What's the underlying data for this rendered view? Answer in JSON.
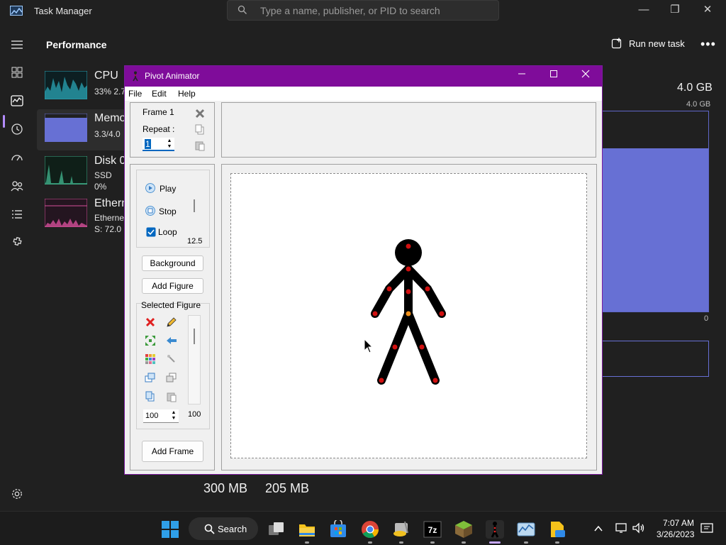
{
  "task_manager": {
    "title": "Task Manager",
    "search_placeholder": "Type a name, publisher, or PID to search",
    "section_title": "Performance",
    "run_new_task_label": "Run new task",
    "more_label": "•••",
    "items": [
      {
        "name": "CPU",
        "sub1": "33% 2.7"
      },
      {
        "name": "Memo",
        "sub1": "3.3/4.0"
      },
      {
        "name": "Disk 0",
        "sub1": "SSD",
        "sub2": "0%"
      },
      {
        "name": "Ethern",
        "sub1": "Etherne",
        "sub2": "S: 72.0"
      }
    ],
    "detail": {
      "total": "4.0 GB",
      "axis_top": "4.0 GB",
      "axis_bottom": "0",
      "usage_fraction": 0.815,
      "stat1": "300 MB",
      "stat2": "205 MB"
    }
  },
  "pivot": {
    "title": "Pivot Animator",
    "menu": [
      "File",
      "Edit",
      "Help"
    ],
    "frame_label": "Frame 1",
    "repeat_label": "Repeat :",
    "repeat_value": "1",
    "play_label": "Play",
    "stop_label": "Stop",
    "loop_label": "Loop",
    "loop_checked": true,
    "speed_value": "12.5",
    "background_label": "Background",
    "add_figure_label": "Add Figure",
    "selected_figure_label": "Selected Figure",
    "size_value": "100",
    "size_slider_value": "100",
    "add_frame_label": "Add Frame"
  },
  "taskbar": {
    "search_label": "Search",
    "time": "7:07 AM",
    "date": "3/26/2023",
    "apps": [
      "start-icon",
      "search",
      "task-view-icon",
      "file-explorer-icon",
      "microsoft-store-icon",
      "chrome-icon",
      "disk-cleanup-icon",
      "7zip-icon",
      "minecraft-icon",
      "pivot-animator-icon",
      "task-manager-icon",
      "notepad-icon"
    ]
  },
  "colors": {
    "pivot_titlebar": "#7f0c9a",
    "memory_accent": "#6770d4",
    "cpu_accent": "#2aa5b5",
    "ethernet_accent": "#d64f9a",
    "joint_red": "#d01010",
    "joint_orange": "#f0901a"
  }
}
